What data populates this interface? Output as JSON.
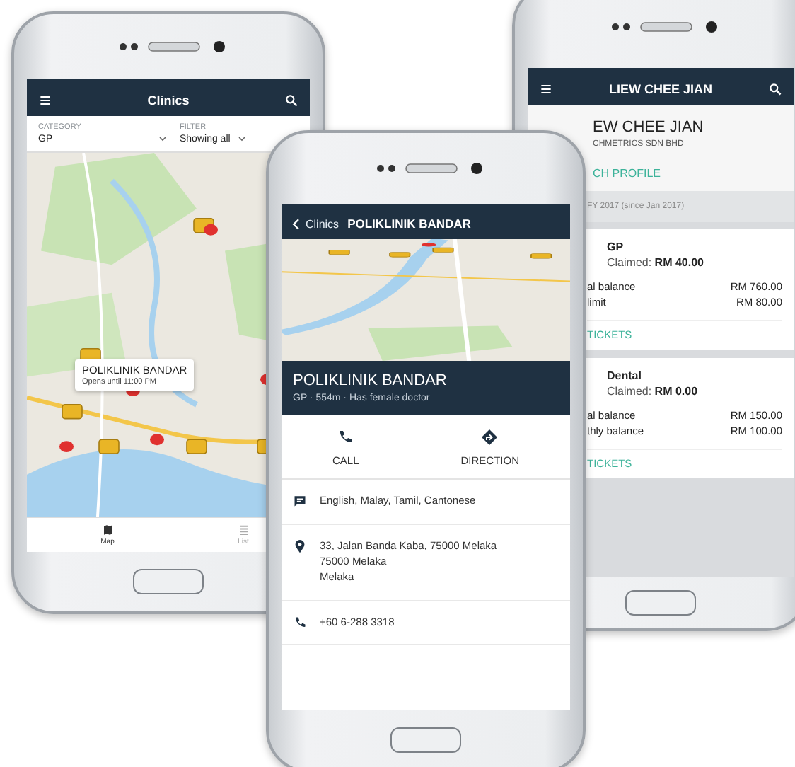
{
  "phones": [
    {
      "kind": "clinic-map",
      "header": {
        "title": "Clinics"
      },
      "filters": [
        {
          "label": "CATEGORY",
          "value": "GP"
        },
        {
          "label": "FILTER",
          "value": "Showing all"
        }
      ],
      "callout": {
        "name": "POLIKLINIK BANDAR",
        "hours": "Opens until 11:00 PM"
      },
      "tabs": [
        {
          "kind": "map",
          "label": "Map",
          "selected": true
        },
        {
          "kind": "list",
          "label": "List",
          "selected": false
        }
      ]
    },
    {
      "kind": "profile",
      "header": {
        "title": "LIEW CHEE JIAN"
      },
      "name": "EW CHEE JIAN",
      "company": "CHMETRICS SDN BHD",
      "link": "CH PROFILE",
      "period": "FY 2017 (since Jan 2017)",
      "benefits": [
        {
          "title": "GP",
          "claimed": "Claimed: **RM 40.00**",
          "rows": [
            {
              "label": "al balance",
              "value": "RM 760.00"
            },
            {
              "label": "limit",
              "value": "RM 80.00"
            }
          ],
          "link": "TICKETS"
        },
        {
          "title": "Dental",
          "claimed": "Claimed: **RM 0.00**",
          "rows": [
            {
              "label": "al balance",
              "value": "RM 150.00"
            },
            {
              "label": "thly balance",
              "value": "RM 100.00"
            }
          ],
          "link": "TICKETS"
        }
      ]
    },
    {
      "kind": "clinic-detail",
      "header": {
        "back": "Clinics",
        "title": "POLIKLINIK BANDAR"
      },
      "clinic": {
        "name": "POLIKLINIK BANDAR",
        "details": "GP · 554m · Has female doctor"
      },
      "actions": [
        {
          "kind": "call",
          "label": "CALL"
        },
        {
          "kind": "direction",
          "label": "DIRECTION"
        }
      ],
      "info": [
        {
          "kind": "languages",
          "lines": [
            "English, Malay, Tamil, Cantonese"
          ]
        },
        {
          "kind": "address",
          "lines": [
            "33, Jalan Banda Kaba, 75000 Melaka",
            "75000 Melaka",
            "Melaka"
          ]
        },
        {
          "kind": "phone",
          "lines": [
            "+60 6-288 3318"
          ]
        }
      ]
    }
  ]
}
